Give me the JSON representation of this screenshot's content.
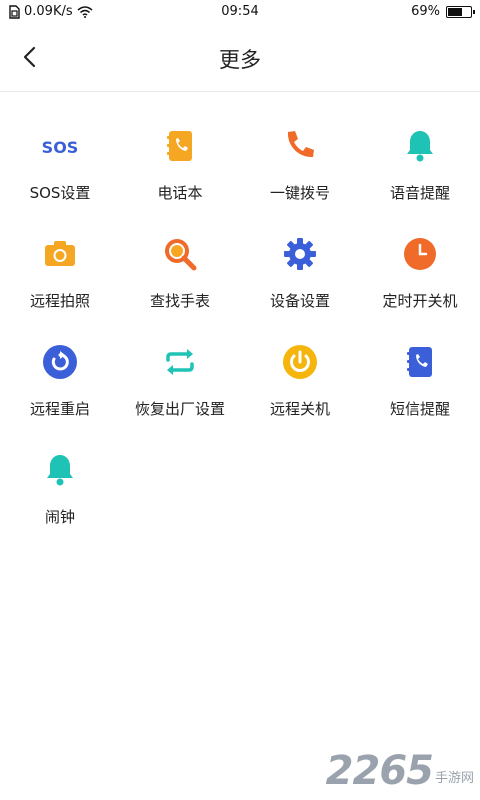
{
  "status_bar": {
    "network_speed": "0.09K/s",
    "time": "09:54",
    "battery": "69%",
    "battery_level": 0.69
  },
  "header": {
    "title": "更多",
    "back_icon": "chevron-left-icon"
  },
  "features": [
    {
      "id": "sos",
      "label": "SOS设置",
      "icon": "sos-icon",
      "icon_text": "SOS",
      "color": "#3b5fd9"
    },
    {
      "id": "phonebook",
      "label": "电话本",
      "icon": "phonebook-icon",
      "color": "#f5a623"
    },
    {
      "id": "one-key-dial",
      "label": "一键拨号",
      "icon": "phone-icon",
      "color": "#f06a2a"
    },
    {
      "id": "voice-reminder",
      "label": "语音提醒",
      "icon": "bell-icon",
      "color": "#1fc3b5"
    },
    {
      "id": "remote-photo",
      "label": "远程拍照",
      "icon": "camera-icon",
      "color": "#f5a623"
    },
    {
      "id": "find-watch",
      "label": "查找手表",
      "icon": "search-icon",
      "color": "#f06a2a"
    },
    {
      "id": "device-settings",
      "label": "设备设置",
      "icon": "gear-icon",
      "color": "#3b5fd9"
    },
    {
      "id": "timed-power",
      "label": "定时开关机",
      "icon": "clock-icon",
      "color": "#f06a2a"
    },
    {
      "id": "remote-restart",
      "label": "远程重启",
      "icon": "restart-icon",
      "color": "#3b5fd9"
    },
    {
      "id": "factory-reset",
      "label": "恢复出厂设置",
      "icon": "reset-arrows-icon",
      "color": "#1fc3b5"
    },
    {
      "id": "remote-shutdown",
      "label": "远程关机",
      "icon": "power-icon",
      "color": "#f5b50c"
    },
    {
      "id": "sms-reminder",
      "label": "短信提醒",
      "icon": "sms-phonebook-icon",
      "color": "#3b5fd9"
    },
    {
      "id": "alarm",
      "label": "闹钟",
      "icon": "alarm-bell-icon",
      "color": "#1fc3b5"
    }
  ],
  "watermark": {
    "number": "2265",
    "text": "手游网"
  }
}
